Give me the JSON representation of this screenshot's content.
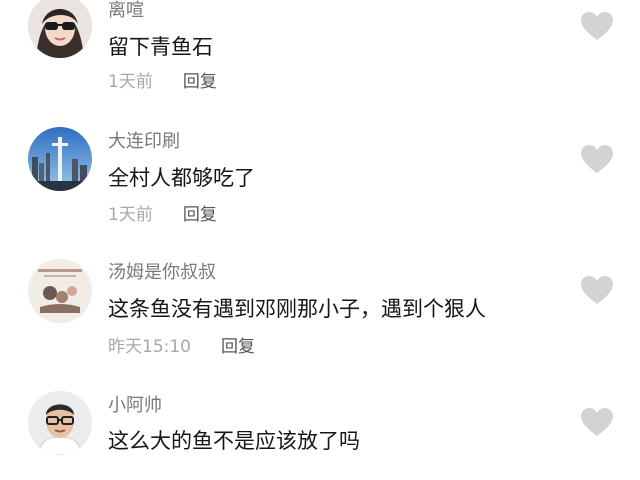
{
  "comments": [
    {
      "avatar": "avatar-woman-sunglasses",
      "username": "离喧",
      "text": "留下青鱼石",
      "time": "1天前",
      "reply_label": "回复",
      "like_icon": "heart-icon"
    },
    {
      "avatar": "avatar-city-skyline",
      "username": "大连印刷",
      "text": "全村人都够吃了",
      "time": "1天前",
      "reply_label": "回复",
      "like_icon": "heart-icon"
    },
    {
      "avatar": "avatar-illustration",
      "username": "汤姆是你叔叔",
      "text": "这条鱼没有遇到邓刚那小子，遇到个狠人",
      "time": "昨天15:10",
      "reply_label": "回复",
      "like_icon": "heart-icon"
    },
    {
      "avatar": "avatar-man-glasses",
      "username": "小阿帅",
      "text": "这么大的鱼不是应该放了吗",
      "like_icon": "heart-icon"
    }
  ],
  "colors": {
    "username": "#7a7a7a",
    "text": "#161616",
    "time": "#a8a8a8",
    "reply": "#555555",
    "heart": "#d3d3d3"
  }
}
